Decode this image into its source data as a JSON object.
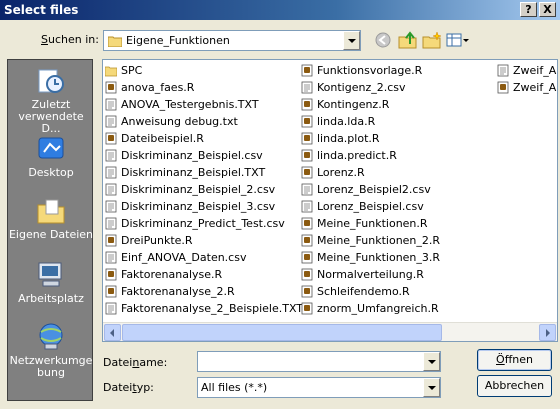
{
  "window": {
    "title": "Select files",
    "help_label": "?",
    "close_label": "X"
  },
  "lookin": {
    "label_pre": "",
    "label_u": "S",
    "label_post": "uchen in:",
    "value": "Eigene_Funktionen"
  },
  "toolbar": [
    "back-icon",
    "up-folder-icon",
    "new-folder-icon",
    "view-menu-icon"
  ],
  "places": [
    {
      "name": "recent",
      "label": "Zuletzt verwendete D...",
      "icon": "recent-docs-icon"
    },
    {
      "name": "desktop",
      "label": "Desktop",
      "icon": "desktop-icon"
    },
    {
      "name": "mydocs",
      "label": "Eigene Dateien",
      "icon": "my-documents-icon"
    },
    {
      "name": "mycomputer",
      "label": "Arbeitsplatz",
      "icon": "my-computer-icon"
    },
    {
      "name": "network",
      "label": "Netzwerkumge bung",
      "icon": "network-icon"
    }
  ],
  "files": {
    "col1": [
      {
        "name": "SPC",
        "type": "folder"
      },
      {
        "name": "anova_faes.R",
        "type": "r"
      },
      {
        "name": "ANOVA_Testergebnis.TXT",
        "type": "txt"
      },
      {
        "name": "Anweisung debug.txt",
        "type": "txt"
      },
      {
        "name": "Dateibeispiel.R",
        "type": "r"
      },
      {
        "name": "Diskriminanz_Beispiel.csv",
        "type": "txt"
      },
      {
        "name": "Diskriminanz_Beispiel.TXT",
        "type": "txt"
      },
      {
        "name": "Diskriminanz_Beispiel_2.csv",
        "type": "txt"
      },
      {
        "name": "Diskriminanz_Beispiel_3.csv",
        "type": "txt"
      },
      {
        "name": "Diskriminanz_Predict_Test.csv",
        "type": "txt"
      },
      {
        "name": "DreiPunkte.R",
        "type": "r"
      },
      {
        "name": "Einf_ANOVA_Daten.csv",
        "type": "txt"
      },
      {
        "name": "Faktorenanalyse.R",
        "type": "r"
      },
      {
        "name": "Faktorenanalyse_2.R",
        "type": "r"
      },
      {
        "name": "Faktorenanalyse_2_Beispiele.TXT",
        "type": "txt"
      }
    ],
    "col2": [
      {
        "name": "Funktionsvorlage.R",
        "type": "r"
      },
      {
        "name": "Kontigenz_2.csv",
        "type": "txt"
      },
      {
        "name": "Kontingenz.R",
        "type": "r"
      },
      {
        "name": "linda.lda.R",
        "type": "r"
      },
      {
        "name": "linda.plot.R",
        "type": "r"
      },
      {
        "name": "linda.predict.R",
        "type": "r"
      },
      {
        "name": "Lorenz.R",
        "type": "r"
      },
      {
        "name": "Lorenz_Beispiel2.csv",
        "type": "txt"
      },
      {
        "name": "Lorenz_Beispiel.csv",
        "type": "txt"
      },
      {
        "name": "Meine_Funktionen.R",
        "type": "r"
      },
      {
        "name": "Meine_Funktionen_2.R",
        "type": "r"
      },
      {
        "name": "Meine_Funktionen_3.R",
        "type": "r"
      },
      {
        "name": "Normalverteilung.R",
        "type": "r"
      },
      {
        "name": "Schleifendemo.R",
        "type": "r"
      },
      {
        "name": "znorm_Umfangreich.R",
        "type": "r"
      }
    ],
    "col3": [
      {
        "name": "Zweif_A",
        "type": "txt"
      },
      {
        "name": "Zweif_A",
        "type": "r"
      }
    ]
  },
  "filename": {
    "label_pre": "Datei",
    "label_u": "n",
    "label_post": "ame:",
    "value": ""
  },
  "filetype": {
    "label_pre": "Datei",
    "label_u": "t",
    "label_post": "yp:",
    "value": "All files (*.*)"
  },
  "buttons": {
    "open_pre": "",
    "open_u": "Ö",
    "open_post": "ffnen",
    "cancel": "Abbrechen"
  }
}
